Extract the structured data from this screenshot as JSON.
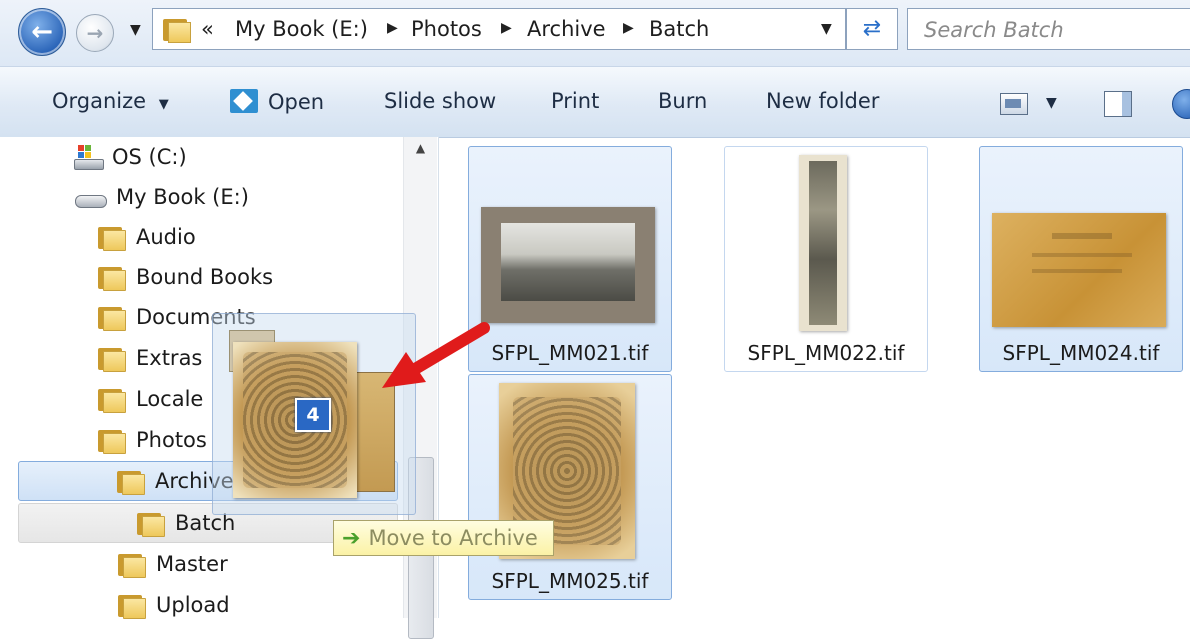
{
  "address": {
    "breadcrumb": [
      "My Book (E:)",
      "Photos",
      "Archive",
      "Batch"
    ],
    "overflow": "«",
    "search_placeholder": "Search Batch"
  },
  "toolbar": {
    "organize": "Organize",
    "open": "Open",
    "slideshow": "Slide show",
    "print": "Print",
    "burn": "Burn",
    "new_folder": "New folder"
  },
  "nav": {
    "drives": [
      {
        "label": "OS (C:)",
        "icon": "windows-drive-icon"
      },
      {
        "label": "My Book (E:)",
        "icon": "external-drive-icon"
      }
    ],
    "folders": [
      {
        "label": "Audio"
      },
      {
        "label": "Bound Books"
      },
      {
        "label": "Documents"
      },
      {
        "label": "Extras"
      },
      {
        "label": "Locale"
      },
      {
        "label": "Photos"
      },
      {
        "label": "Archive",
        "state": "drop-target"
      },
      {
        "label": "Batch",
        "state": "current"
      },
      {
        "label": "Master"
      },
      {
        "label": "Upload"
      }
    ]
  },
  "files": [
    {
      "name": "SFPL_MM021.tif",
      "selected": true
    },
    {
      "name": "SFPL_MM022.tif",
      "selected": false
    },
    {
      "name": "SFPL_MM024.tif",
      "selected": true
    },
    {
      "name": "SFPL_MM025.tif",
      "selected": true
    }
  ],
  "drag": {
    "count": "4",
    "tooltip": "Move to Archive"
  },
  "colors": {
    "selection": "#d7e7f9",
    "selection_border": "#84acdd",
    "badge": "#2a68c4",
    "annotation_arrow": "#e01b1b",
    "tooltip_bg": "#fbf2a6"
  }
}
